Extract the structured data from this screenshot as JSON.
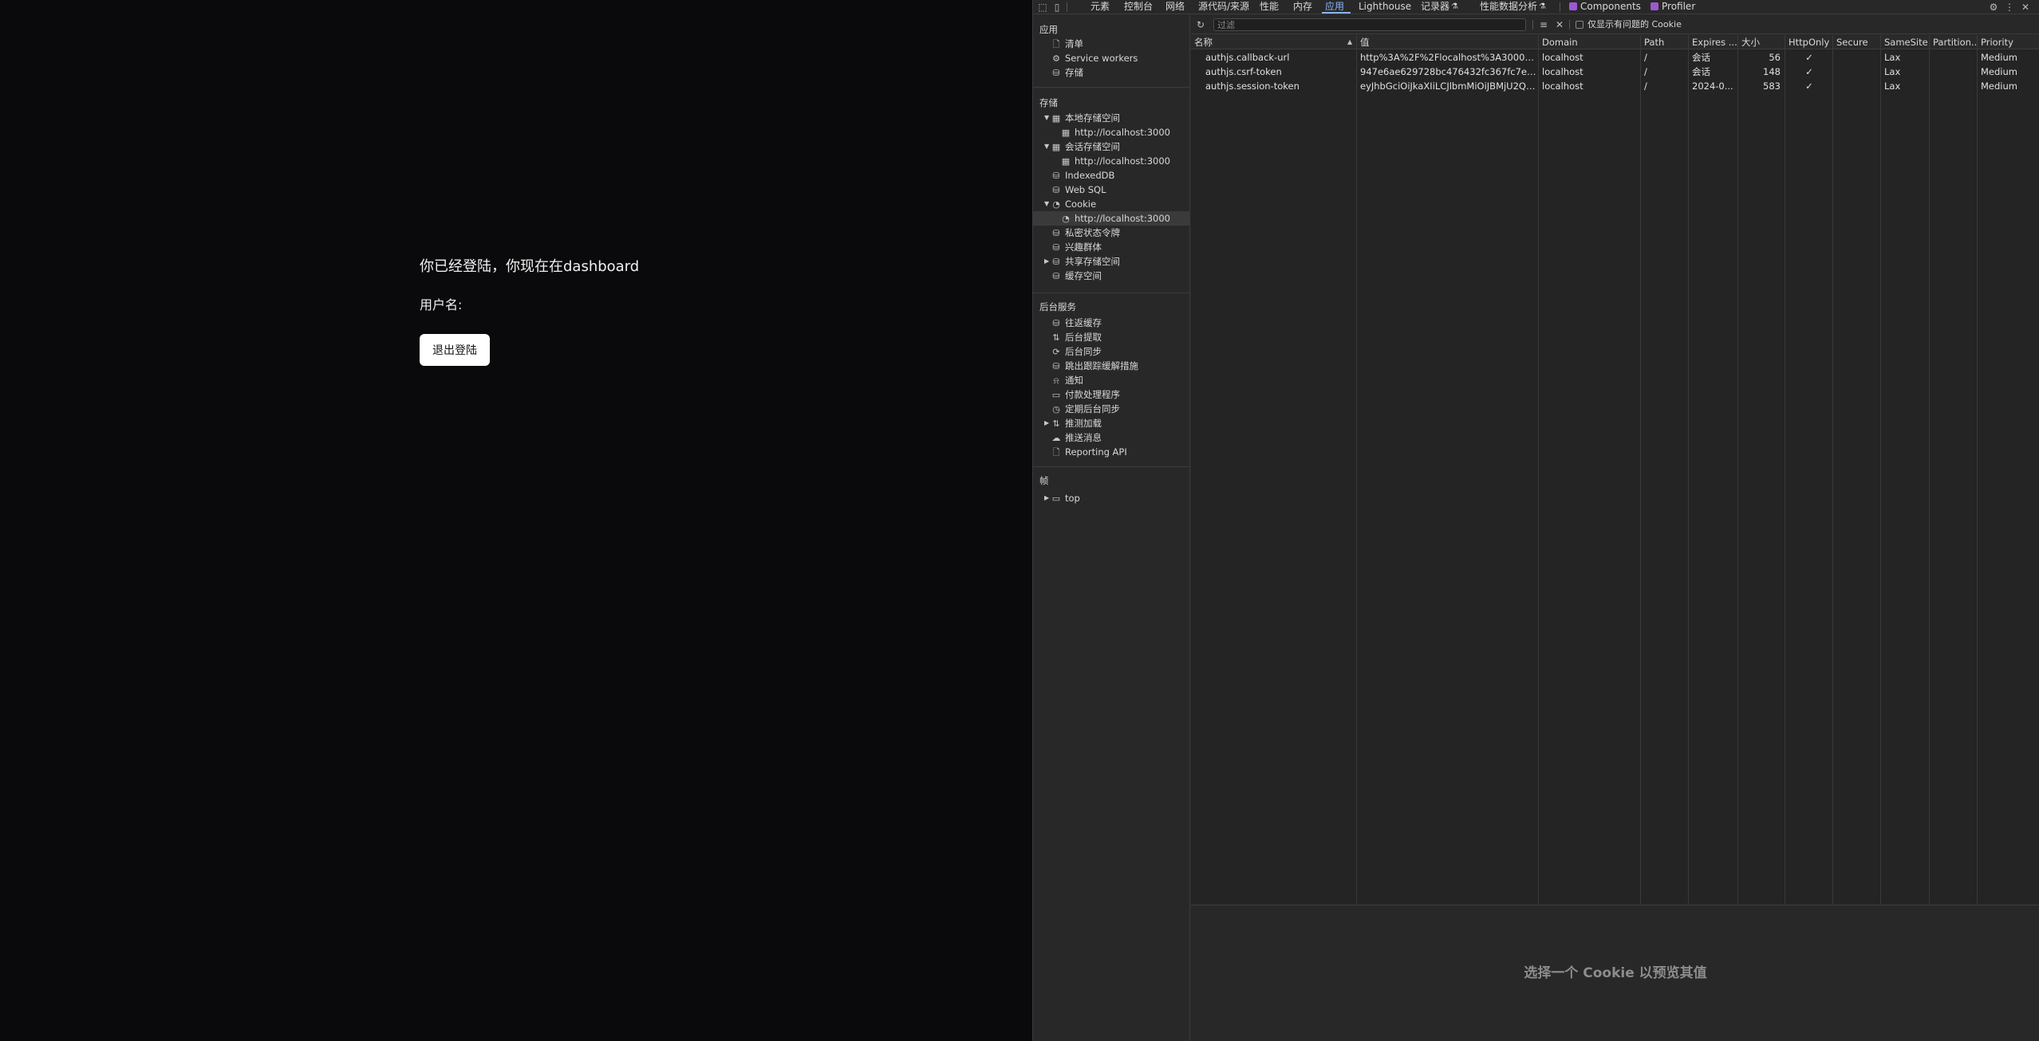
{
  "page": {
    "title": "你已经登陆，你现在在dashboard",
    "username_label": "用户名:",
    "logout_label": "退出登陆"
  },
  "devtools": {
    "tabs": [
      {
        "label": "元素",
        "active": false
      },
      {
        "label": "控制台",
        "active": false
      },
      {
        "label": "网络",
        "active": false
      },
      {
        "label": "源代码/来源",
        "active": false
      },
      {
        "label": "性能",
        "active": false
      },
      {
        "label": "内存",
        "active": false
      },
      {
        "label": "应用",
        "active": true
      },
      {
        "label": "Lighthouse",
        "active": false
      },
      {
        "label": "记录器",
        "active": false
      },
      {
        "label": "性能数据分析",
        "active": false
      },
      {
        "label": "Components",
        "active": false
      },
      {
        "label": "Profiler",
        "active": false
      }
    ],
    "lab_glyph": "⚗",
    "sidebar": {
      "app_title": "应用",
      "app_items": [
        {
          "label": "清单",
          "icon": "file-icon"
        },
        {
          "label": "Service workers",
          "icon": "gear-icon"
        },
        {
          "label": "存储",
          "icon": "database-icon"
        }
      ],
      "storage_title": "存储",
      "storage_items": [
        {
          "label": "本地存储空间",
          "icon": "table-icon"
        },
        {
          "label": "http://localhost:3000",
          "icon": "table-icon"
        },
        {
          "label": "会话存储空间",
          "icon": "table-icon"
        },
        {
          "label": "http://localhost:3000",
          "icon": "table-icon"
        },
        {
          "label": "IndexedDB",
          "icon": "database-icon"
        },
        {
          "label": "Web SQL",
          "icon": "database-icon"
        },
        {
          "label": "Cookie",
          "icon": "cookie-icon"
        },
        {
          "label": "http://localhost:3000",
          "icon": "cookie-icon"
        },
        {
          "label": "私密状态令牌",
          "icon": "database-icon"
        },
        {
          "label": "兴趣群体",
          "icon": "database-icon"
        },
        {
          "label": "共享存储空间",
          "icon": "database-icon"
        },
        {
          "label": "缓存空间",
          "icon": "database-icon"
        }
      ],
      "bg_title": "后台服务",
      "bg_items": [
        {
          "label": "往返缓存",
          "icon": "database-icon"
        },
        {
          "label": "后台提取",
          "icon": "fetch-icon"
        },
        {
          "label": "后台同步",
          "icon": "sync-icon"
        },
        {
          "label": "跳出跟踪缓解措施",
          "icon": "database-icon"
        },
        {
          "label": "通知",
          "icon": "bell-icon"
        },
        {
          "label": "付款处理程序",
          "icon": "card-icon"
        },
        {
          "label": "定期后台同步",
          "icon": "clock-icon"
        },
        {
          "label": "推测加载",
          "icon": "fetch-icon"
        },
        {
          "label": "推送消息",
          "icon": "cloud-icon"
        },
        {
          "label": "Reporting API",
          "icon": "file-icon"
        }
      ],
      "frames_title": "帧",
      "frames_items": [
        {
          "label": "top",
          "icon": "frame-icon"
        }
      ]
    },
    "toolbar": {
      "filter_placeholder": "过滤",
      "only_issues_label": "仅显示有问题的 Cookie"
    },
    "table": {
      "columns": [
        "名称",
        "值",
        "Domain",
        "Path",
        "Expires ...",
        "大小",
        "HttpOnly",
        "Secure",
        "SameSite",
        "Partition...",
        "Priority"
      ],
      "rows": [
        [
          "authjs.callback-url",
          "http%3A%2F%2Flocalhost%3A3000%2F...",
          "localhost",
          "/",
          "会话",
          "56",
          "✓",
          "",
          "Lax",
          "",
          "Medium"
        ],
        [
          "authjs.csrf-token",
          "947e6ae629728bc476432fc367fc7e88b...",
          "localhost",
          "/",
          "会话",
          "148",
          "✓",
          "",
          "Lax",
          "",
          "Medium"
        ],
        [
          "authjs.session-token",
          "eyJhbGciOiJkaXIiLCJlbmMiOiJBMjU2Q0J...",
          "localhost",
          "/",
          "2024-0...",
          "583",
          "✓",
          "",
          "Lax",
          "",
          "Medium"
        ]
      ]
    },
    "preview_message": "选择一个 Cookie 以预览其值"
  }
}
